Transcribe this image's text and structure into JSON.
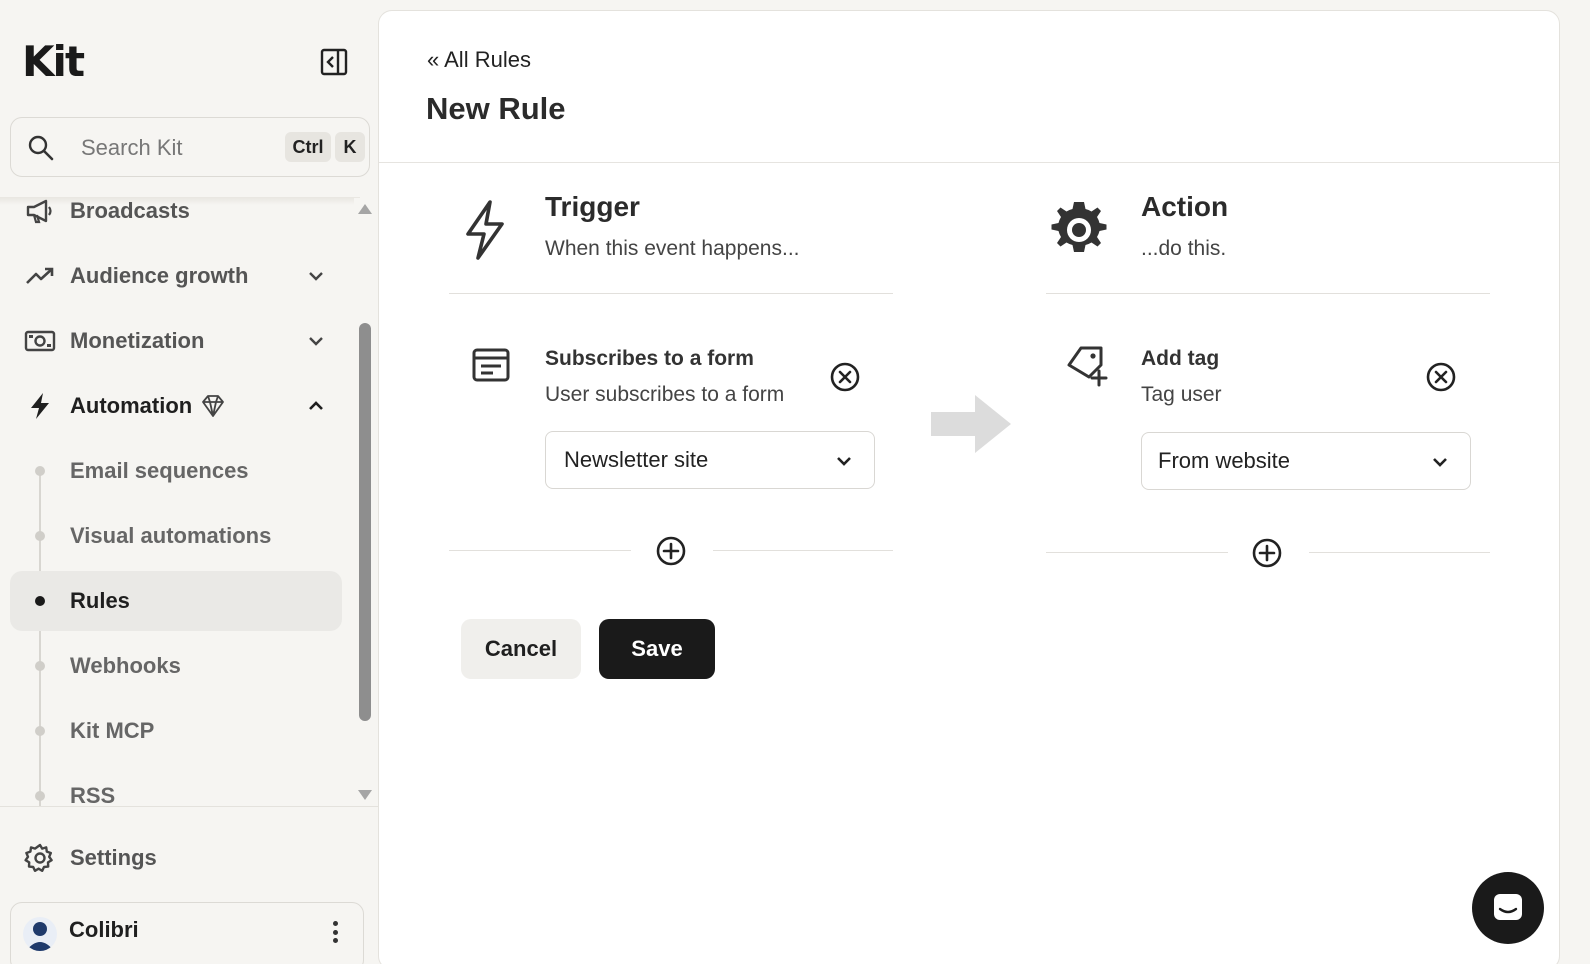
{
  "app": {
    "logo": "Kit"
  },
  "search": {
    "placeholder": "Search Kit",
    "shortcut_ctrl": "Ctrl",
    "shortcut_key": "K"
  },
  "sidebar": {
    "items": [
      {
        "label": "Broadcasts",
        "icon": "megaphone-icon"
      },
      {
        "label": "Audience growth",
        "icon": "trending-up-icon"
      },
      {
        "label": "Monetization",
        "icon": "money-icon"
      },
      {
        "label": "Automation",
        "icon": "lightning-icon"
      }
    ],
    "automation_sub": [
      {
        "label": "Email sequences"
      },
      {
        "label": "Visual automations"
      },
      {
        "label": "Rules",
        "active": true
      },
      {
        "label": "Webhooks"
      },
      {
        "label": "Kit MCP"
      },
      {
        "label": "RSS"
      }
    ],
    "settings_label": "Settings",
    "user_name": "Colibri"
  },
  "page": {
    "back_link": "« All Rules",
    "title": "New Rule"
  },
  "trigger": {
    "title": "Trigger",
    "subtitle": "When this event happens...",
    "card_title": "Subscribes to a form",
    "card_subtitle": "User subscribes to a form",
    "selected": "Newsletter site"
  },
  "action": {
    "title": "Action",
    "subtitle": "...do this.",
    "card_title": "Add tag",
    "card_subtitle": "Tag user",
    "selected": "From website"
  },
  "buttons": {
    "cancel": "Cancel",
    "save": "Save"
  },
  "colors": {
    "primary": "#1a1a1a",
    "sidebar_bg": "#f6f5f2",
    "active_bg": "#eae9e6"
  }
}
